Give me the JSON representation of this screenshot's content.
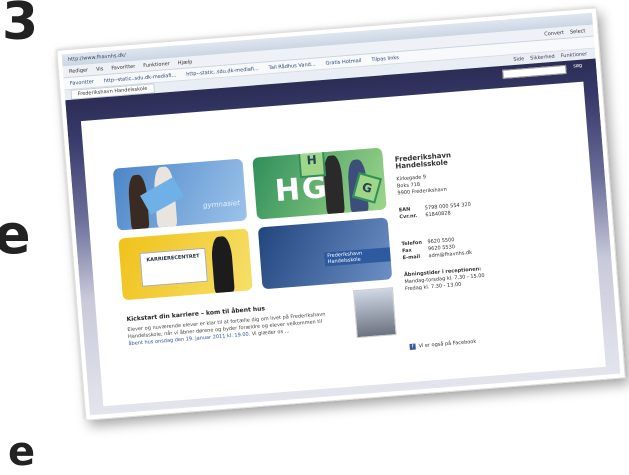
{
  "slide_chars": {
    "top": "3",
    "middle": "e",
    "bottom": "e"
  },
  "browser": {
    "address_text": "http://www.fhavnhs.dk/",
    "menu": [
      "Rediger",
      "Vis",
      "Favoritter",
      "Funktioner",
      "Hjælp"
    ],
    "menu_right": [
      "Convert",
      "Select"
    ],
    "favorites_label": "Favoritter",
    "favorites": [
      "http--static..sdu.dk-mediafi...",
      "http--static..sdu.dk-mediafi...",
      "Tail Rådhus Vand...",
      "Gratis Hotmail",
      "Tilpas links"
    ],
    "tab_title": "Frederikshavn Handelsskole",
    "tools": [
      "Side",
      "Sikkerhed",
      "Funktioner"
    ]
  },
  "site": {
    "search_label": "søg",
    "tiles": {
      "gym_label": "gymnasiet",
      "hg_label": "HG",
      "karriere_label": "KARRIERECENTRET",
      "building_label": "Frederikshavn Handelsskole"
    },
    "info": {
      "name": "Frederikshavn Handelsskole",
      "address_1": "Kirkegade 9",
      "address_2": "Boks 718",
      "address_3": "9900 Frederikshavn",
      "ean_key": "EAN",
      "ean_val": "5798 000 554 320",
      "cvr_key": "Cvr.nr.",
      "cvr_val": "61840828",
      "phone_key": "Telefon",
      "phone_val": "9620 5500",
      "fax_key": "Fax",
      "fax_val": "9620 5530",
      "email_key": "E-mail",
      "email_val": "adm@fhavnhs.dk",
      "hours_title": "Åbningstider i receptionen:",
      "hours_1": "Mandag-torsdag kl. 7.30 - 15.00",
      "hours_2": "Fredag kl. 7.30 - 13.00"
    },
    "news": {
      "headline": "Kickstart din karriere – kom til åbent hus",
      "body": "Elever og nuværende elever er klar til at fortælle dig om livet på Frederikshavn Handelsskole, når vi åbner dørene og byder forældre og elever velkommen til",
      "link": "åbent hus onsdag den 19. januar 2011 kl. 19.00.",
      "tail": "Vi glæder os ..."
    },
    "facebook_label": "Vi er også på Facebook"
  },
  "colors": {
    "header_dark": "#2b2d55",
    "accent_green": "#2f8f5a",
    "accent_blue": "#4c86c8",
    "accent_yellow": "#f0c21a"
  }
}
